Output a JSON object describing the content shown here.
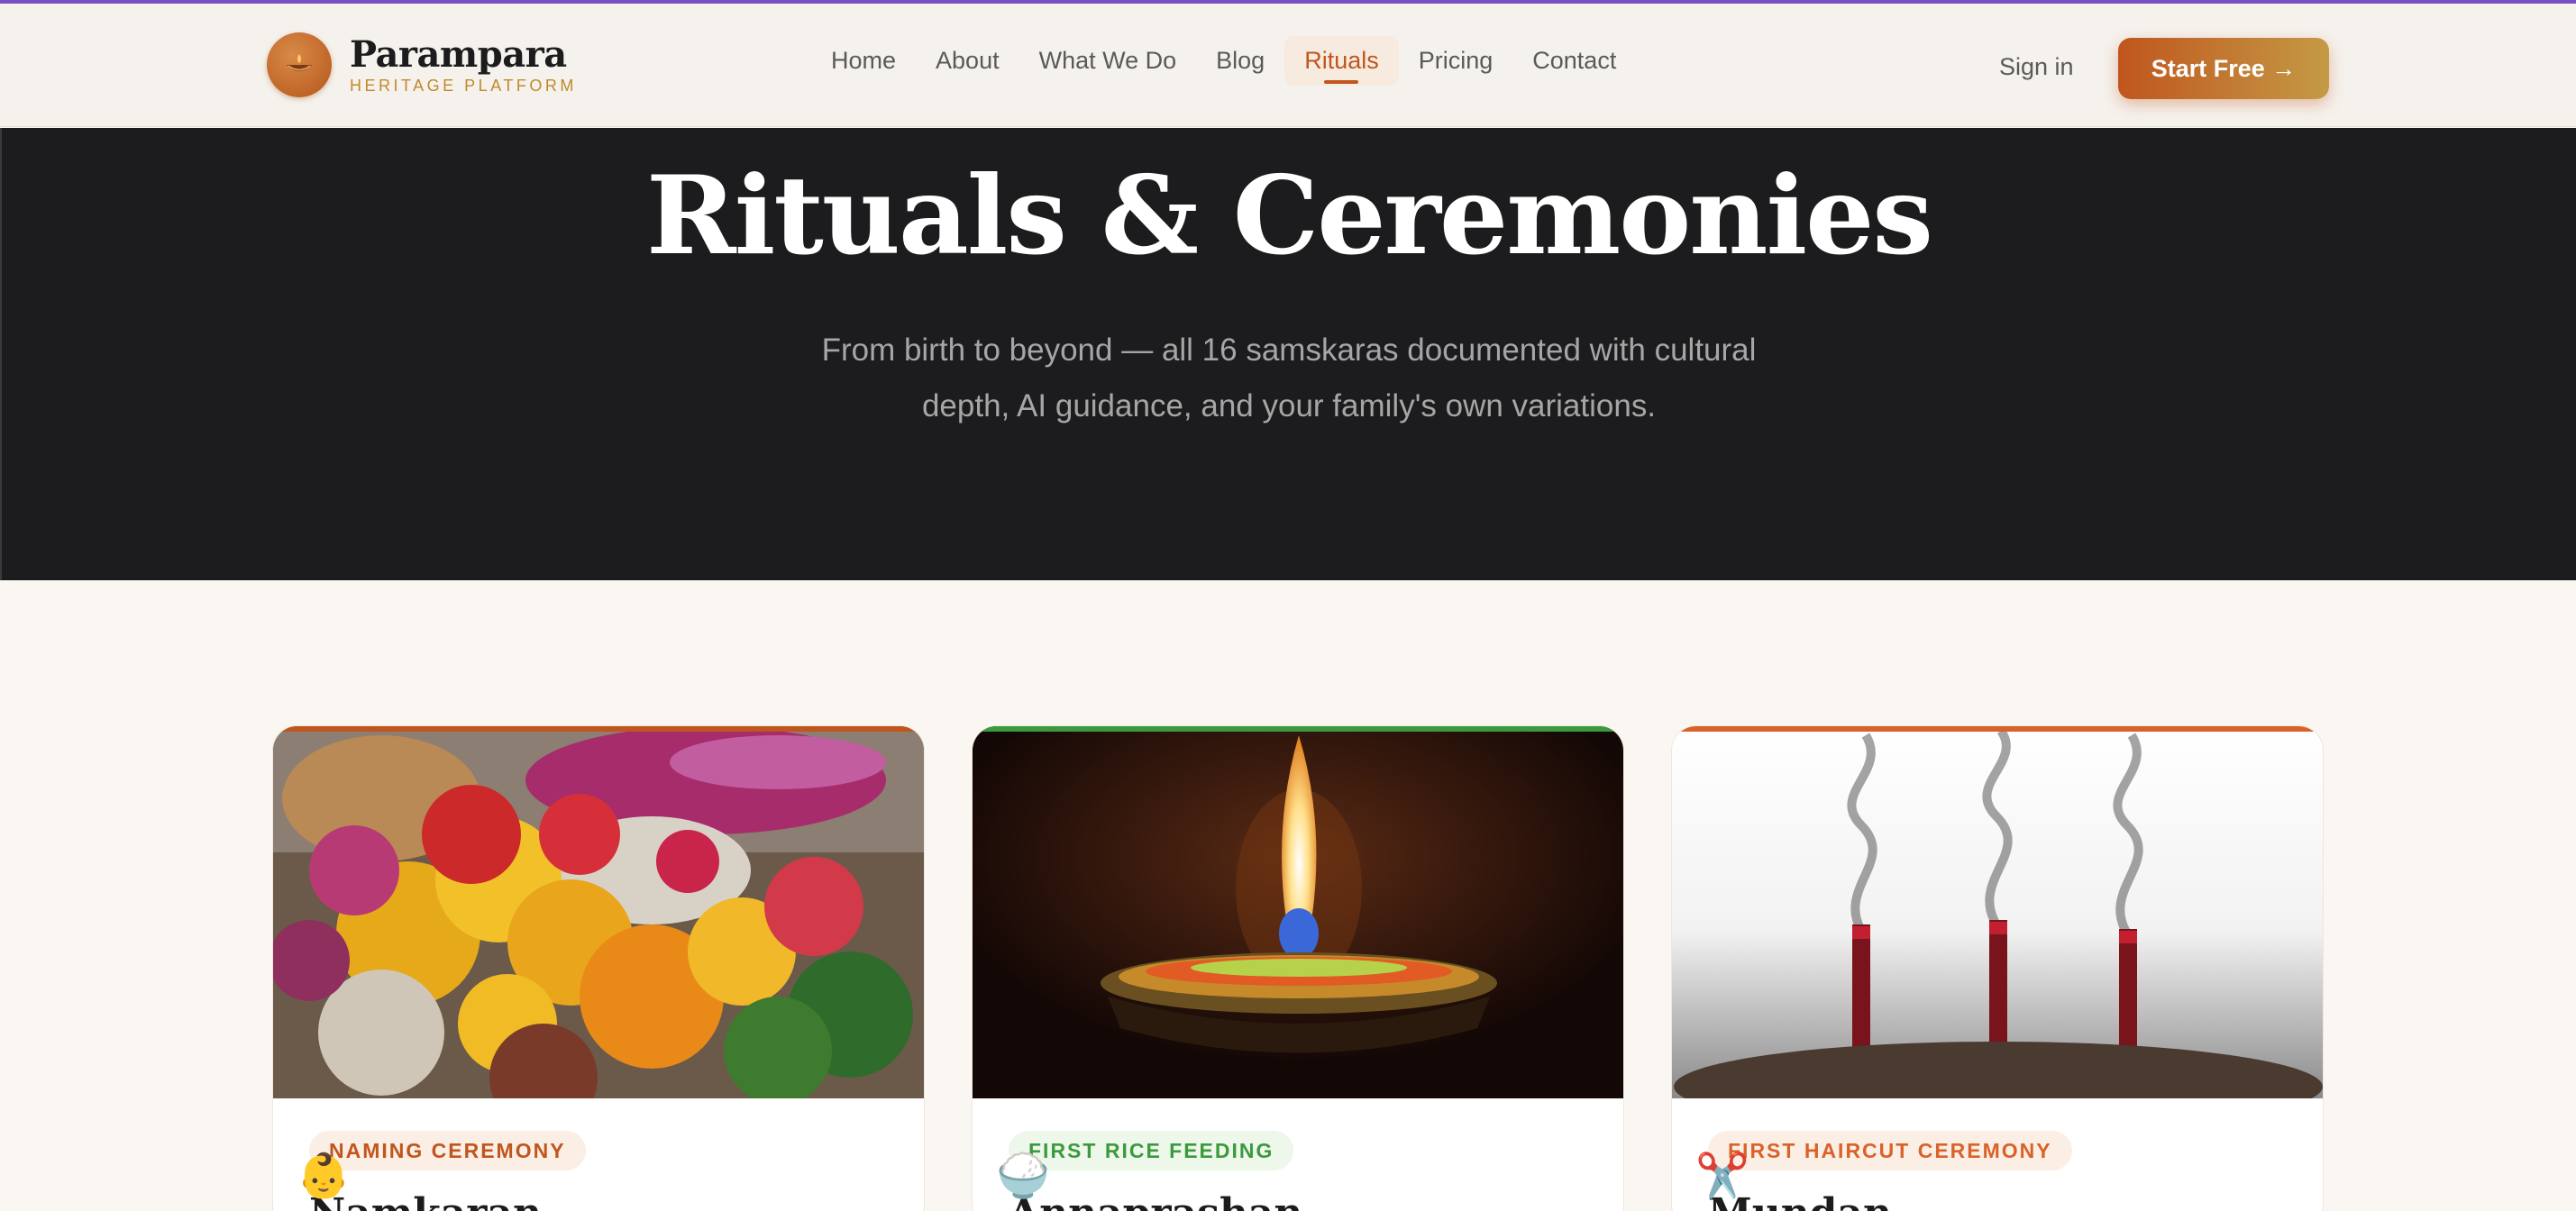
{
  "brand": {
    "name": "Parampara",
    "tagline": "HERITAGE PLATFORM",
    "icon": "diya-lamp-icon"
  },
  "nav": {
    "links": [
      {
        "label": "Home",
        "active": false
      },
      {
        "label": "About",
        "active": false
      },
      {
        "label": "What We Do",
        "active": false
      },
      {
        "label": "Blog",
        "active": false
      },
      {
        "label": "Rituals",
        "active": true
      },
      {
        "label": "Pricing",
        "active": false
      },
      {
        "label": "Contact",
        "active": false
      }
    ],
    "signin_label": "Sign in",
    "cta_label": "Start Free →"
  },
  "hero": {
    "title": "Rituals & Ceremonies",
    "subtitle": "From birth to beyond — all 16 samskaras documented with cultural depth, AI guidance, and your family's own variations."
  },
  "cards": [
    {
      "tag": "NAMING CEREMONY",
      "title": "Namkaran",
      "emoji": "👶",
      "image": "marigold-flower-offerings",
      "accent": "#c0561e",
      "tag_color": "#c0561e",
      "tag_bg": "#fbeee4"
    },
    {
      "tag": "FIRST RICE FEEDING",
      "title": "Annaprashan",
      "emoji": "🍚",
      "image": "lit-diya-lamp",
      "accent": "#3c9a3e",
      "tag_color": "#3c9a3e",
      "tag_bg": "#edf7ea"
    },
    {
      "tag": "FIRST HAIRCUT CEREMONY",
      "title": "Mundan",
      "emoji": "✂️",
      "image": "incense-sticks-smoke",
      "accent": "#d9622a",
      "tag_color": "#d9622a",
      "tag_bg": "#fbeee4"
    }
  ],
  "colors": {
    "accent": "#c0561e",
    "gold": "#c49a45",
    "hero_bg": "#1c1c1e",
    "page_bg": "#faf6f1"
  }
}
